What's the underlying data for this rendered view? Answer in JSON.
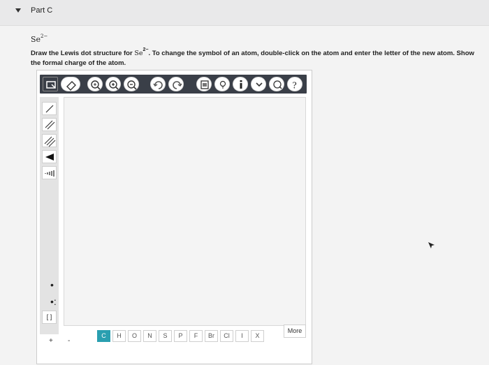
{
  "header": {
    "title": "Part C"
  },
  "question": {
    "formula_base": "Se",
    "formula_charge": "2−",
    "instruction_pre": "Draw the Lewis dot structure for ",
    "instruction_post": ". To change the symbol of an atom, double-click on the atom and enter the letter of the new atom. Show the formal charge of the atom."
  },
  "toolbar": {
    "icons": [
      "select-icon",
      "eraser-icon",
      "zoom-fit-icon",
      "zoom-in-icon",
      "zoom-out-icon",
      "undo-icon",
      "redo-icon",
      "template-icon",
      "hint-icon",
      "info-icon",
      "chevron-down-icon",
      "help-icon"
    ]
  },
  "sidebar": {
    "tools": [
      "single-bond-icon",
      "double-bond-icon",
      "triple-bond-icon",
      "wedge-bond-icon",
      "hash-bond-icon"
    ],
    "lone_pair_tools": [
      "•",
      "•:"
    ],
    "bracket_label": "[ ]"
  },
  "bottom": {
    "plus": "+",
    "minus": "-",
    "elements": [
      "C",
      "H",
      "O",
      "N",
      "S",
      "P",
      "F",
      "Br",
      "Cl",
      "I",
      "X"
    ],
    "active_element": "C",
    "more_label": "More"
  },
  "colors": {
    "toolbar": "#3a3f48",
    "active": "#2a9fb0"
  }
}
